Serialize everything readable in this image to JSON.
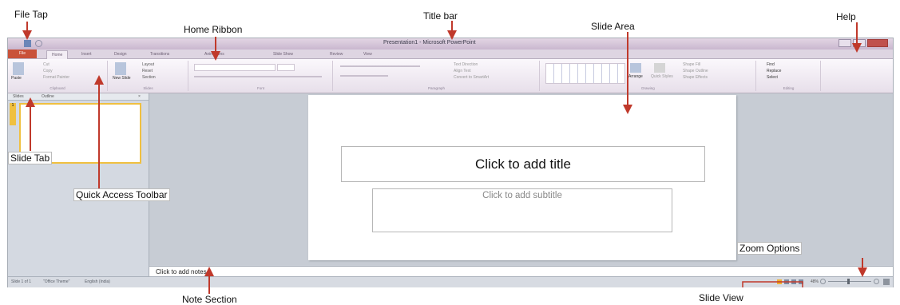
{
  "window": {
    "title": "Presentation1 - Microsoft PowerPoint",
    "tabs": [
      "File",
      "Home",
      "Insert",
      "Design",
      "Transitions",
      "Animations",
      "Slide Show",
      "Review",
      "View"
    ]
  },
  "ribbon": {
    "groups": [
      "Clipboard",
      "Slides",
      "Font",
      "Paragraph",
      "Drawing",
      "Editing"
    ],
    "clipboard_items": [
      "Paste",
      "Cut",
      "Copy",
      "Format Painter"
    ],
    "slides_items": [
      "New Slide",
      "Layout",
      "Reset",
      "Section"
    ],
    "paragraph_items": [
      "Text Direction",
      "Align Text",
      "Convert to SmartArt"
    ],
    "drawing_items": [
      "Arrange",
      "Quick Styles",
      "Shape Fill",
      "Shape Outline",
      "Shape Effects"
    ],
    "editing_items": [
      "Find",
      "Replace",
      "Select"
    ]
  },
  "slides_pane": {
    "tabs": [
      "Slides",
      "Outline"
    ],
    "thumb_number": "1"
  },
  "slide": {
    "title_placeholder": "Click to add title",
    "subtitle_placeholder": "Click to add subtitle"
  },
  "notes": {
    "placeholder": "Click to add notes"
  },
  "status_bar": {
    "slide_info": "Slide 1 of 1",
    "theme": "\"Office Theme\"",
    "language": "English (India)",
    "zoom": "48%"
  },
  "annotations": {
    "file_tab": "File Tap",
    "home_ribbon": "Home Ribbon",
    "title_bar": "Title bar",
    "slide_area": "Slide Area",
    "help": "Help",
    "slide_tab": "Slide Tab",
    "quick_access_toolbar": "Quick Access Toolbar",
    "zoom_options": "Zoom Options",
    "note_section": "Note Section",
    "slide_view": "Slide View"
  },
  "colors": {
    "file_tab": "#c9523a",
    "titlebar": "#d6c8db",
    "accent": "#f0c040",
    "annotation_arrow": "#c0392b"
  }
}
